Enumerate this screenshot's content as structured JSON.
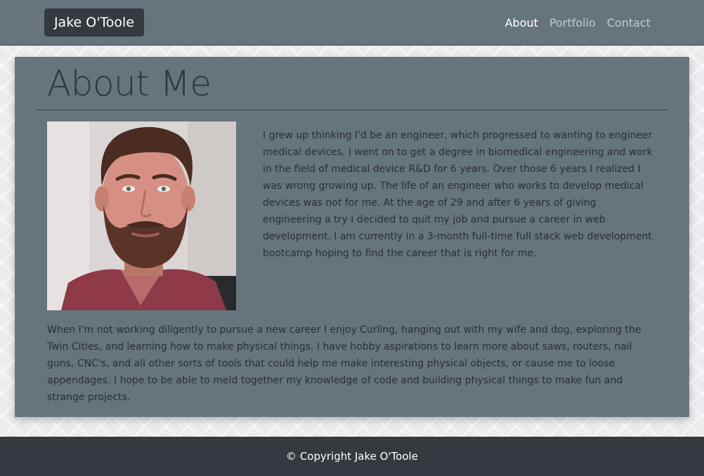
{
  "navbar": {
    "brand": "Jake O'Toole",
    "links": [
      {
        "label": "About",
        "active": true
      },
      {
        "label": "Portfolio",
        "active": false
      },
      {
        "label": "Contact",
        "active": false
      }
    ]
  },
  "main": {
    "title": "About Me",
    "photo_icon": "profile-photo",
    "bio_paragraph_1": "I grew up thinking I'd be an engineer, which progressed to wanting to engineer medical devices. I went on to get a degree in biomedical engineering and work in the field of medical device R&D for 6 years. Over those 6 years I realized I was wrong growing up. The life of an engineer who works to develop medical devices was not for me. At the age of 29 and after 6 years of giving engineering a try I decided to quit my job and pursue a career in web development. I am currently in a 3-month full-time full stack web development bootcamp hoping to find the career that is right for me.",
    "bio_paragraph_2": "When I'm not working diligently to pursue a new career I enjoy Curling, hanging out with my wife and dog, exploring the Twin Cities, and learning how to make physical things. I have hobby aspirations to learn more about saws, routers, nail guns, CNC's, and all other sorts of tools that could help me make interesting physical objects, or cause me to loose appendages. I hope to be able to meld together my knowledge of code and building physical things to make fun and strange projects."
  },
  "footer": {
    "copyright": "© Copyright Jake O'Toole"
  },
  "colors": {
    "navbar_bg": "#66747c",
    "card_bg": "#66747c",
    "brand_bg": "#343a40",
    "footer_bg": "#343a40"
  }
}
